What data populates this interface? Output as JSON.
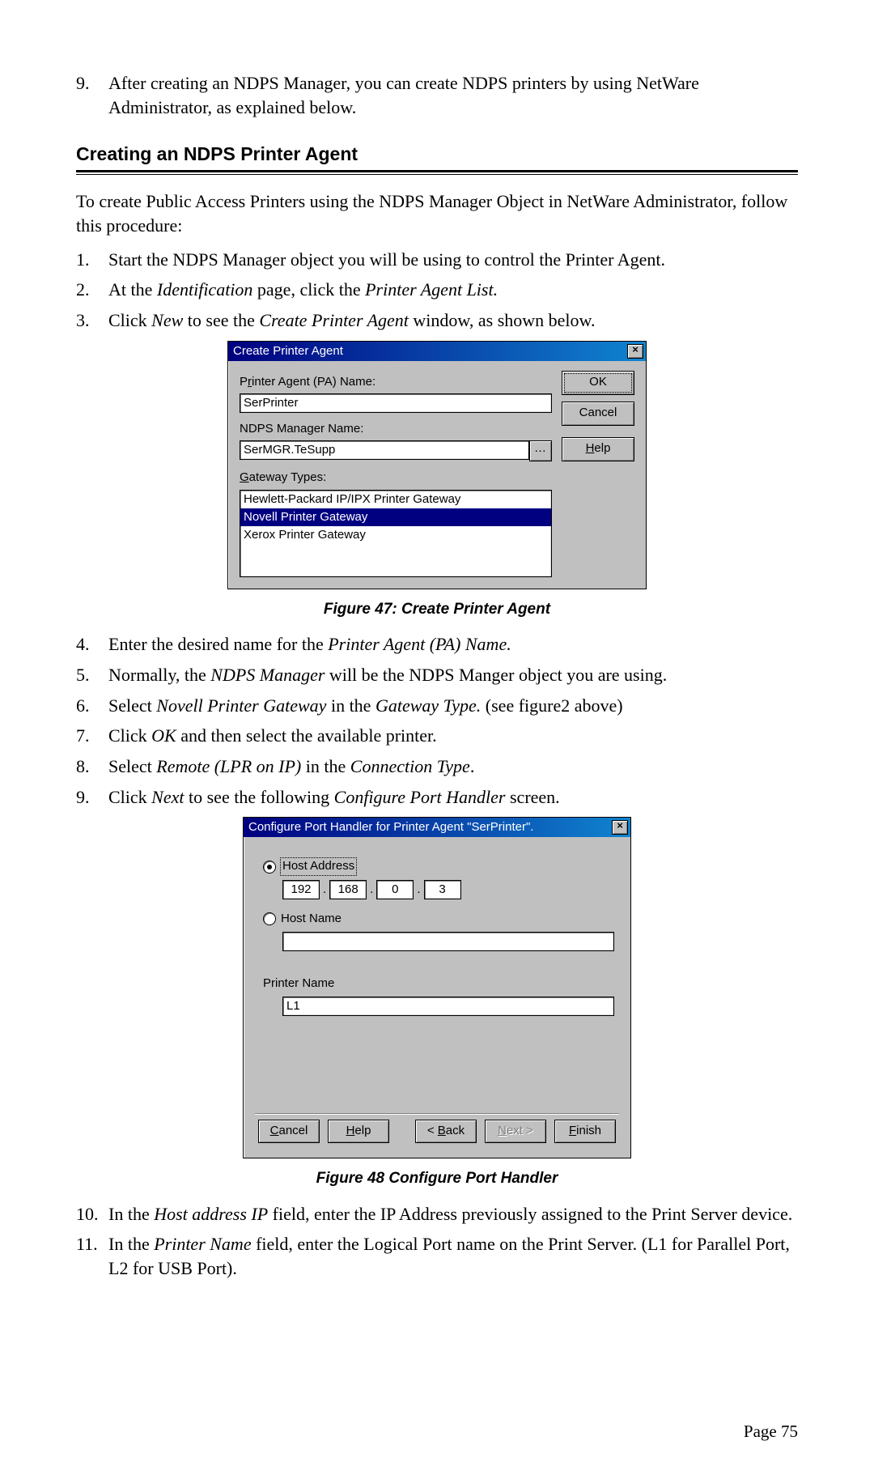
{
  "intro": {
    "nine": "9.",
    "nine_text": "After creating an NDPS Manager, you can create NDPS printers by using NetWare Administrator, as explained below."
  },
  "section_title": "Creating an NDPS Printer Agent",
  "para1": "To create Public Access Printers using the NDPS Manager Object in NetWare Administrator, follow this procedure:",
  "steps_a": {
    "1": {
      "n": "1.",
      "t": "Start the NDPS Manager object you will be using to control the Printer Agent."
    },
    "2": {
      "n": "2.",
      "pre": "At the ",
      "i1": "Identification",
      "mid": " page, click the ",
      "i2": "Printer Agent List."
    },
    "3": {
      "n": "3.",
      "pre": "Click ",
      "i1": "New",
      "mid": " to see the ",
      "i2": "Create Printer Agent",
      "suf": " window, as shown below."
    }
  },
  "dialog1": {
    "title": "Create Printer Agent",
    "close": "×",
    "pa_label_pre": "P",
    "pa_label_u": "r",
    "pa_label_post": "inter Agent (PA) Name:",
    "pa_value": "SerPrinter",
    "mgr_label": "NDPS Manager Name:",
    "mgr_value": "SerMGR.TeSupp",
    "browse": "…",
    "gw_label_u": "G",
    "gw_label_post": "ateway Types:",
    "gw_items": {
      "0": "Hewlett-Packard IP/IPX Printer Gateway",
      "1": "Novell Printer Gateway",
      "2": "Xerox Printer Gateway"
    },
    "ok": "OK",
    "cancel": "Cancel",
    "help_u": "H",
    "help_post": "elp"
  },
  "fig47": "Figure 47: Create Printer Agent",
  "steps_b": {
    "4": {
      "n": "4.",
      "pre": "Enter the desired name for the ",
      "i": "Printer Agent (PA) Name."
    },
    "5": {
      "n": "5.",
      "pre": "Normally, the ",
      "i": "NDPS Manager",
      "suf": " will be the NDPS Manger object you are using."
    },
    "6": {
      "n": "6.",
      "pre": "Select ",
      "i1": "Novell Printer Gateway",
      "mid": " in the ",
      "i2": "Gateway Type.",
      "suf": " (see figure2 above)"
    },
    "7": {
      "n": "7.",
      "pre": "Click ",
      "i": "OK",
      "suf": " and then select the available printer."
    },
    "8": {
      "n": "8.",
      "pre": "Select ",
      "i1": "Remote (LPR on IP)",
      "mid": " in the ",
      "i2": "Connection Type",
      "suf": "."
    },
    "9": {
      "n": "9.",
      "pre": "Click ",
      "i1": "Next",
      "mid": " to see the following ",
      "i2": "Configure Port Handler",
      "suf": " screen."
    }
  },
  "dialog2": {
    "title": "Configure Port Handler for Printer Agent \"SerPrinter\".",
    "close": "×",
    "host_addr": "Host Address",
    "ip": {
      "a": "192",
      "b": "168",
      "c": "0",
      "d": "3"
    },
    "host_name": "Host Name",
    "printer_name_label": "Printer Name",
    "printer_name_value": "L1",
    "cancel_u": "C",
    "cancel_post": "ancel",
    "help_u": "H",
    "help_post": "elp",
    "back_pre": "< ",
    "back_u": "B",
    "back_post": "ack",
    "next_u": "N",
    "next_post": "ext >",
    "finish_u": "F",
    "finish_post": "inish"
  },
  "fig48": "Figure 48 Configure Port Handler",
  "steps_c": {
    "10": {
      "n": "10.",
      "pre": "In the ",
      "i": "Host address IP",
      "suf": " field, enter the IP Address previously assigned to the Print Server device."
    },
    "11": {
      "n": "11.",
      "pre": "In the ",
      "i": "Printer Name",
      "suf": " field, enter the Logical Port name on the Print Server. (L1 for Parallel Port, L2 for USB Port)."
    }
  },
  "page_number": "Page 75"
}
